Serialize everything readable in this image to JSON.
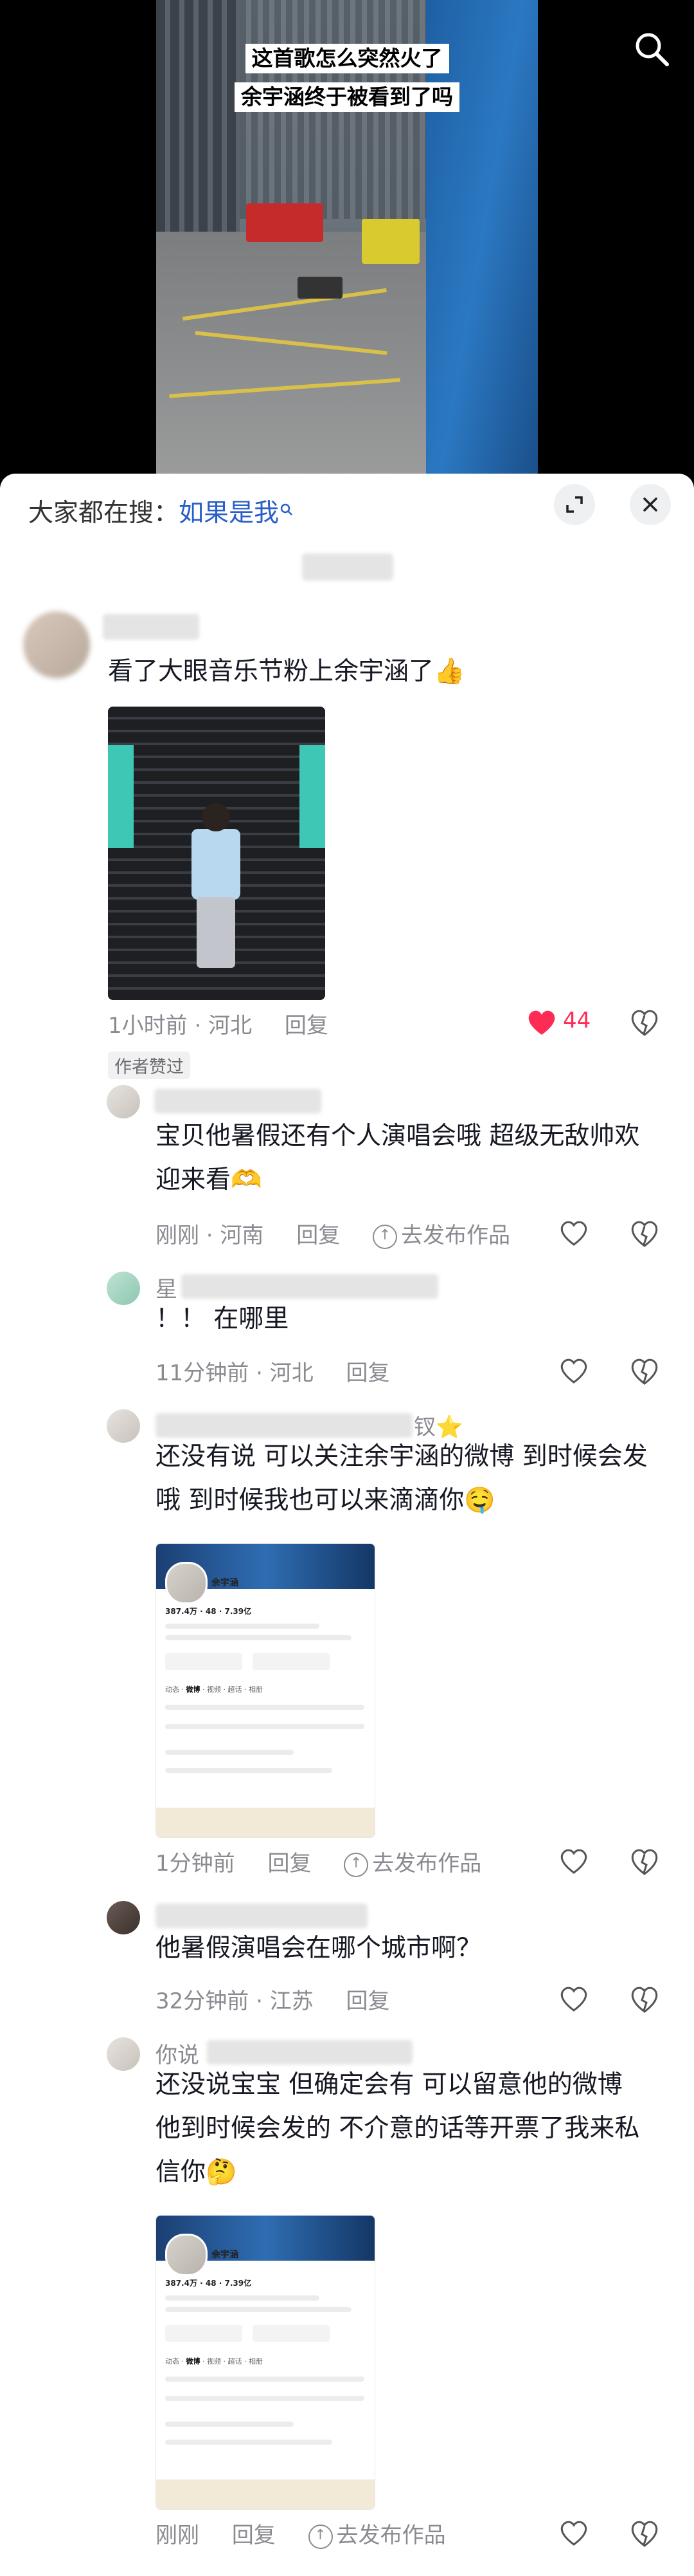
{
  "video": {
    "caption_line1": "这首歌怎么突然火了",
    "caption_line2": "余宇涵终于被看到了吗"
  },
  "header": {
    "prefix": "大家都在搜：",
    "keyword": "如果是我"
  },
  "comments": [
    {
      "text": "看了大眼音乐节粉上余宇涵了👍",
      "time": "1小时前",
      "location": "河北",
      "reply_label": "回复",
      "likes": "44",
      "author_tag": "作者赞过"
    },
    {
      "name_visible": "",
      "text": "宝贝他暑假还有个人演唱会哦 超级无敌帅欢迎来看🫶",
      "time": "刚刚",
      "location": "河南",
      "reply_label": "回复",
      "publish_label": "去发布作品"
    },
    {
      "name_visible": "星",
      "text": "！！ 在哪里",
      "time": "11分钟前",
      "location": "河北",
      "reply_label": "回复"
    },
    {
      "name_visible": "钗⭐",
      "text": "还没有说 可以关注余宇涵的微博 到时候会发哦 到时候我也可以来滴滴你🤤",
      "time": "1分钟前",
      "reply_label": "回复",
      "publish_label": "去发布作品"
    },
    {
      "name_visible": "",
      "text": "他暑假演唱会在哪个城市啊？",
      "time": "32分钟前",
      "location": "江苏",
      "reply_label": "回复"
    },
    {
      "name_visible": "你说",
      "text": "还没说宝宝 但确定会有 可以留意他的微博 他到时候会发的 不介意的话等开票了我来私信你🤔",
      "time": "刚刚",
      "reply_label": "回复",
      "publish_label": "去发布作品"
    }
  ],
  "profile_shot": {
    "name": "余宇涵",
    "followers": "387.4万",
    "following": "48",
    "views": "7.39亿",
    "tab_active": "微博",
    "tabs": [
      "动态",
      "微博",
      "视频",
      "超话",
      "相册"
    ]
  },
  "colors": {
    "accent_blue": "#2a5ec9",
    "like_red": "#fe2c55"
  }
}
